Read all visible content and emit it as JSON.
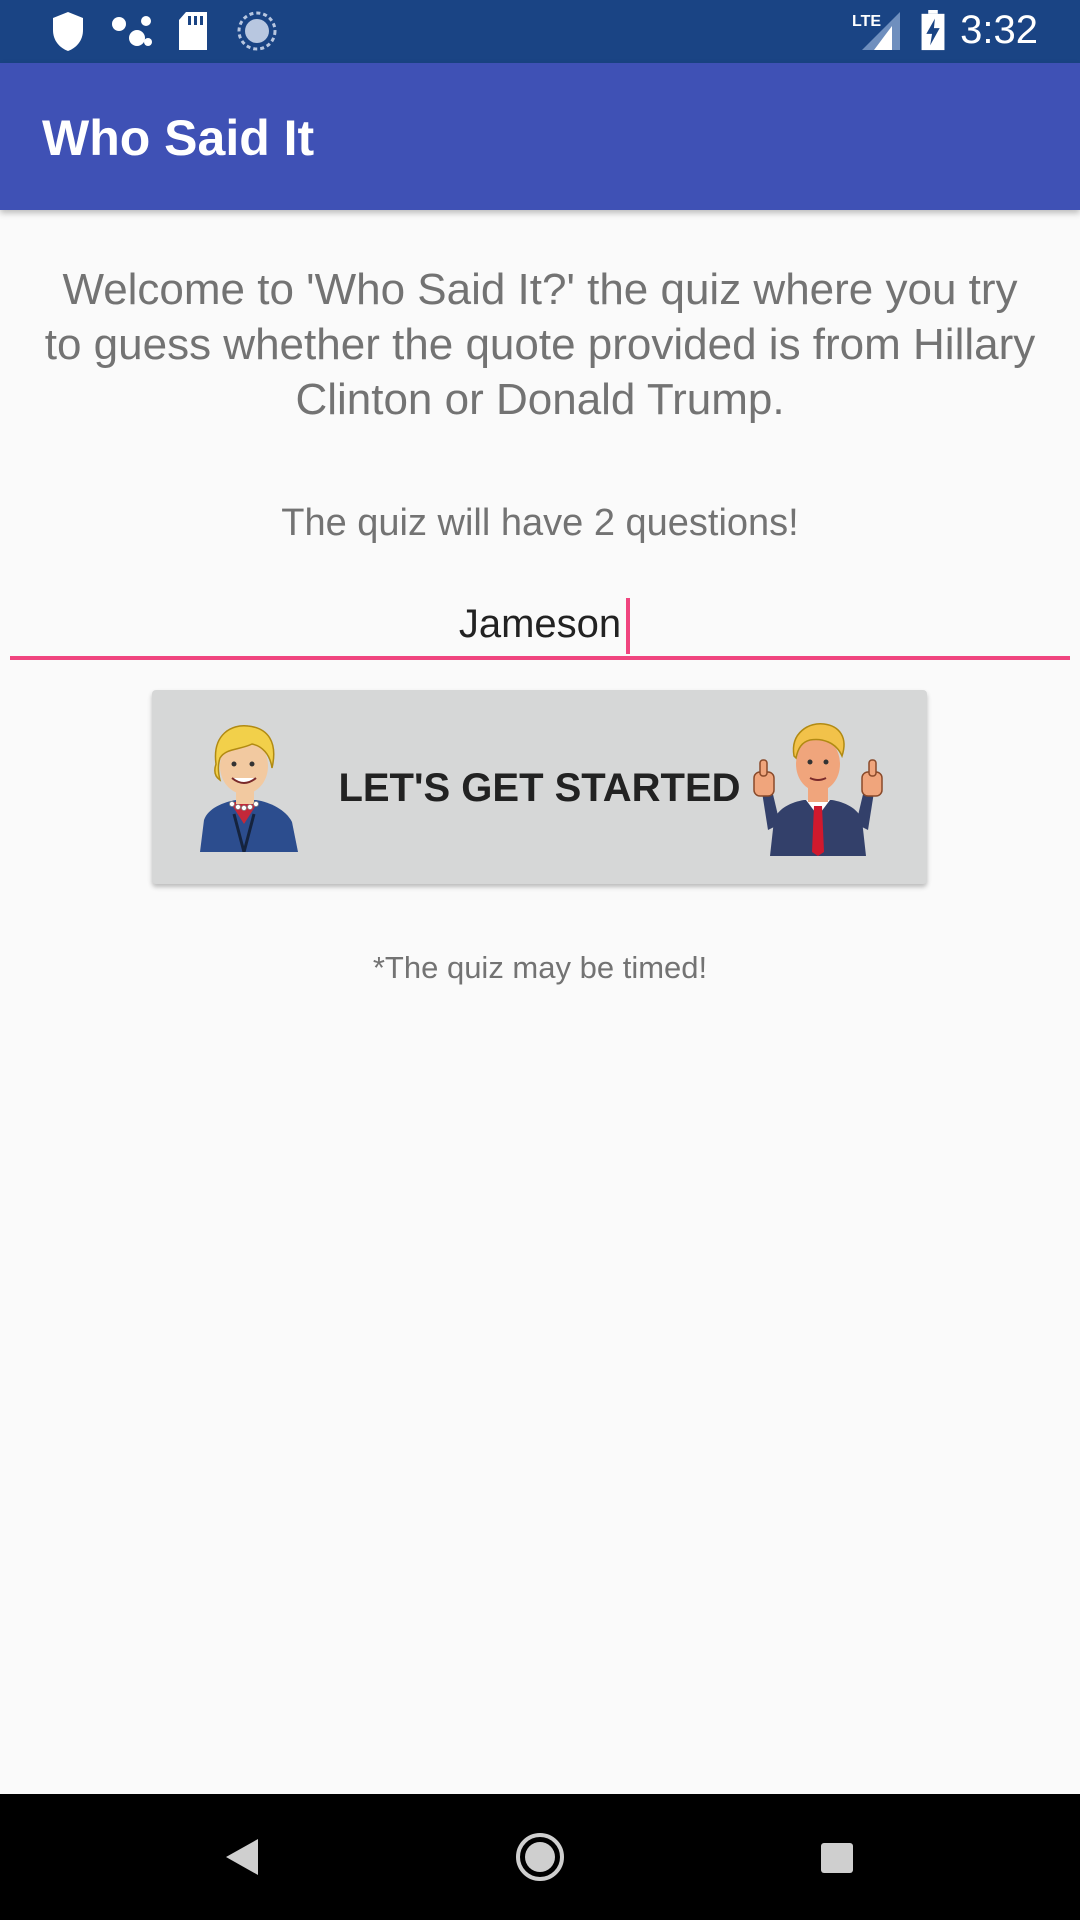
{
  "status_bar": {
    "time": "3:32",
    "network": "LTE",
    "icons": [
      "shield-icon",
      "dots-icon",
      "sd-card-icon",
      "sync-icon",
      "lte-signal-icon",
      "battery-charging-icon"
    ]
  },
  "app_bar": {
    "title": "Who Said It"
  },
  "main": {
    "welcome": "Welcome to 'Who Said It?' the quiz where you try to guess whether the quote provided is from Hillary Clinton or Donald Trump.",
    "question_count": "The quiz will have 2 questions!",
    "name_value": "Jameson",
    "start_label": "LET'S GET STARTED",
    "note": "*The quiz may be timed!"
  },
  "nav_bar": {
    "icons": [
      "back-icon",
      "home-icon",
      "recents-icon"
    ]
  },
  "colors": {
    "status_bar": "#1a4484",
    "app_bar": "#3f51b5",
    "accent": "#f0457f",
    "button": "#d6d7d7",
    "body_text": "#737373"
  }
}
